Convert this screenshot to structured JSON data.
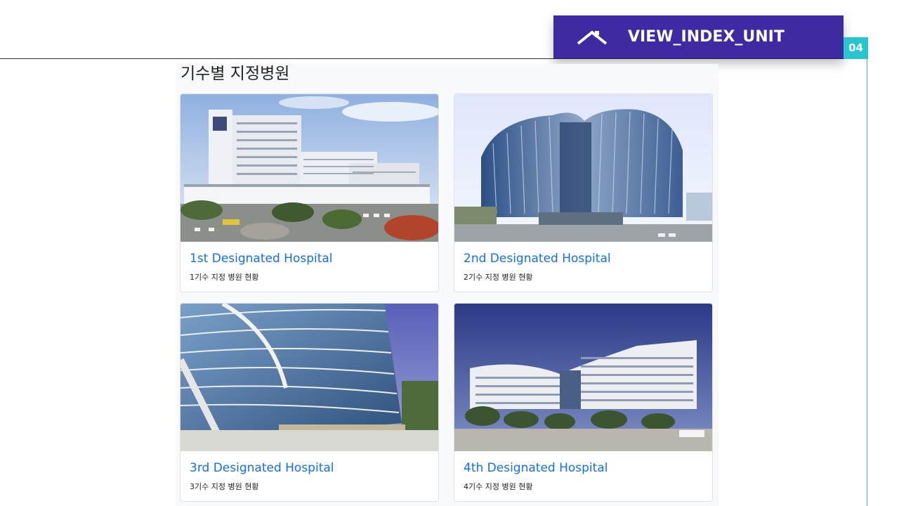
{
  "slide": {
    "title": "VIEW_INDEX_UNIT",
    "page_number": "04",
    "header_icon": "chevron-up-icon",
    "colors": {
      "banner": "#3f2aa3",
      "page_badge": "#26c6d0",
      "link": "#0d6efd"
    }
  },
  "section": {
    "heading": "기수별 지정병원"
  },
  "cards": [
    {
      "title": "1st Designated Hospital",
      "text": "1기수 지정 병원 현황",
      "image": "hospital-building-photo"
    },
    {
      "title": "2nd Designated Hospital",
      "text": "2기수 지정 병원 현황",
      "image": "hospital-building-photo"
    },
    {
      "title": "3rd Designated Hospital",
      "text": "3기수 지정 병원 현황",
      "image": "hospital-building-photo"
    },
    {
      "title": "4th Designated Hospital",
      "text": "4기수 지정 병원 현황",
      "image": "hospital-building-photo"
    }
  ]
}
